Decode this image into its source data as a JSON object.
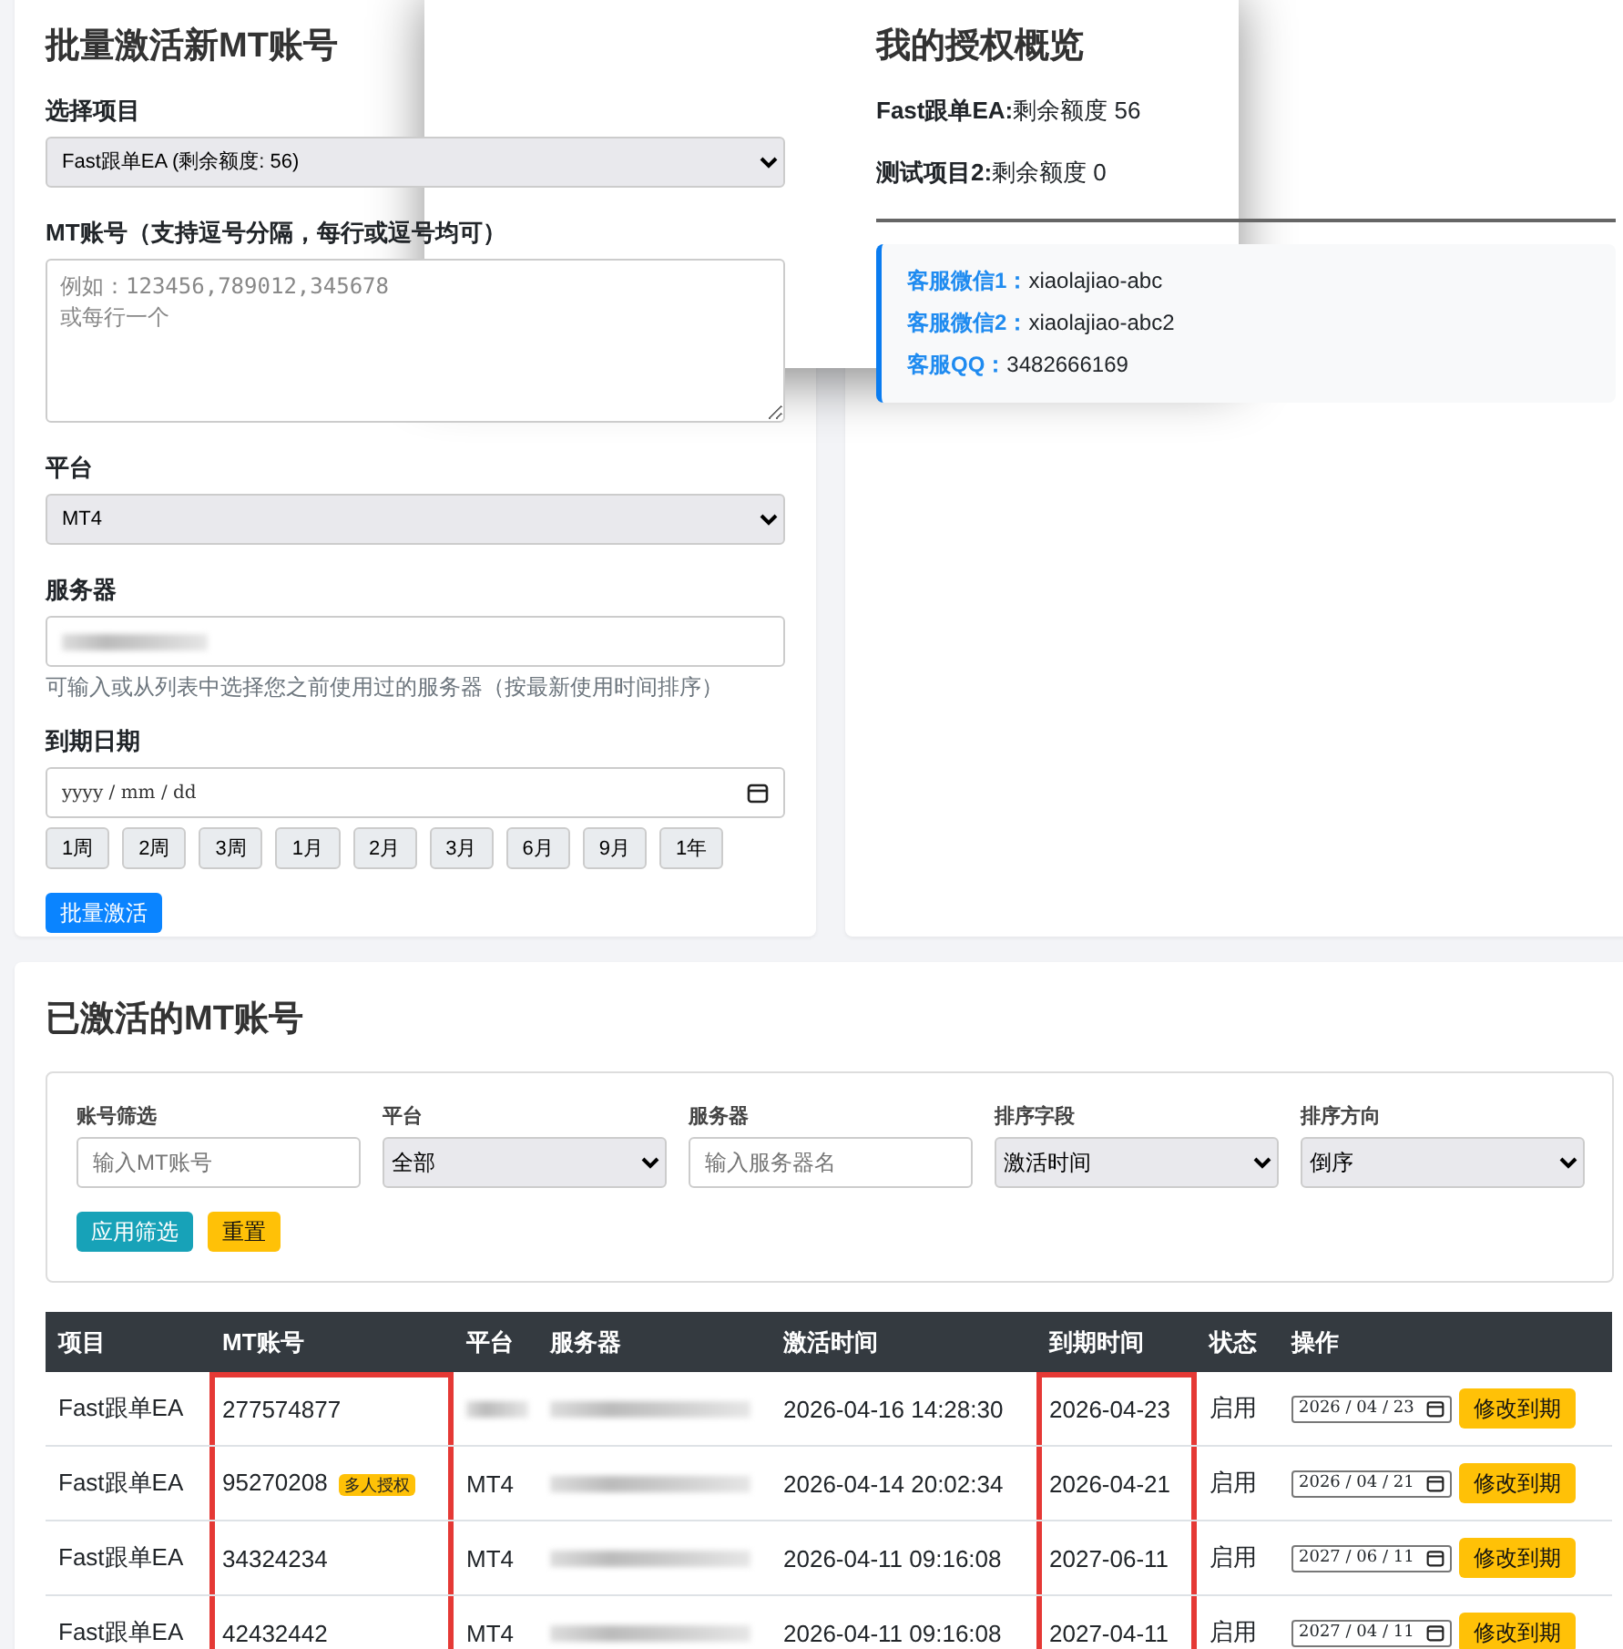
{
  "activate_form": {
    "title": "批量激活新MT账号",
    "project": {
      "label": "选择项目",
      "value": "Fast跟单EA (剩余额度: 56)"
    },
    "accounts": {
      "label": "MT账号（支持逗号分隔，每行或逗号均可）",
      "placeholder": "例如：123456,789012,345678\n或每行一个"
    },
    "platform": {
      "label": "平台",
      "value": "MT4"
    },
    "server": {
      "label": "服务器",
      "redacted": true,
      "help": "可输入或从列表中选择您之前使用过的服务器（按最新使用时间排序）"
    },
    "expiry": {
      "label": "到期日期",
      "placeholder": "yyyy / mm / dd"
    },
    "quick_buttons": [
      "1周",
      "2周",
      "3周",
      "1月",
      "2月",
      "3月",
      "6月",
      "9月",
      "1年"
    ],
    "submit": "批量激活"
  },
  "overview": {
    "title": "我的授权概览",
    "quotas": [
      {
        "name": "Fast跟单EA:",
        "text": "剩余额度 56"
      },
      {
        "name": "测试项目2:",
        "text": "剩余额度 0"
      }
    ],
    "contacts": [
      {
        "label": "客服微信1：",
        "value": "xiaolajiao-abc"
      },
      {
        "label": "客服微信2：",
        "value": "xiaolajiao-abc2"
      },
      {
        "label": "客服QQ：",
        "value": "3482666169"
      }
    ]
  },
  "popup": {
    "visible": true
  },
  "accounts_list": {
    "title": "已激活的MT账号",
    "filters": [
      {
        "kind": "input",
        "label": "账号筛选",
        "placeholder": "输入MT账号"
      },
      {
        "kind": "select",
        "label": "平台",
        "value": "全部"
      },
      {
        "kind": "input",
        "label": "服务器",
        "placeholder": "输入服务器名"
      },
      {
        "kind": "select",
        "label": "排序字段",
        "value": "激活时间"
      },
      {
        "kind": "select",
        "label": "排序方向",
        "value": "倒序"
      }
    ],
    "apply_button": "应用筛选",
    "reset_button": "重置",
    "columns": [
      {
        "label": "项目",
        "highlighted": false
      },
      {
        "label": "MT账号",
        "highlighted": true
      },
      {
        "label": "平台",
        "highlighted": false
      },
      {
        "label": "服务器",
        "highlighted": false
      },
      {
        "label": "激活时间",
        "highlighted": false
      },
      {
        "label": "到期时间",
        "highlighted": true
      },
      {
        "label": "状态",
        "highlighted": false
      },
      {
        "label": "操作",
        "highlighted": false
      }
    ],
    "rows": [
      {
        "project": "Fast跟单EA",
        "account": "277574877",
        "platform_redacted": true,
        "activated": "2026-04-16 14:28:30",
        "expires": "2026-04-23",
        "status": "启用",
        "date_value": "2026 / 04 / 23",
        "action": "修改到期"
      },
      {
        "project": "Fast跟单EA",
        "account": "95270208",
        "badge": "多人授权",
        "platform": "MT4",
        "activated": "2026-04-14 20:02:34",
        "expires": "2026-04-21",
        "status": "启用",
        "date_value": "2026 / 04 / 21",
        "action": "修改到期"
      },
      {
        "project": "Fast跟单EA",
        "account": "34324234",
        "platform": "MT4",
        "activated": "2026-04-11 09:16:08",
        "expires": "2027-06-11",
        "status": "启用",
        "date_value": "2027 / 06 / 11",
        "action": "修改到期"
      },
      {
        "project": "Fast跟单EA",
        "account": "42432442",
        "platform": "MT4",
        "activated": "2026-04-11 09:16:08",
        "expires": "2027-04-11",
        "status": "启用",
        "date_value": "2027 / 04 / 11",
        "action": "修改到期"
      }
    ]
  }
}
